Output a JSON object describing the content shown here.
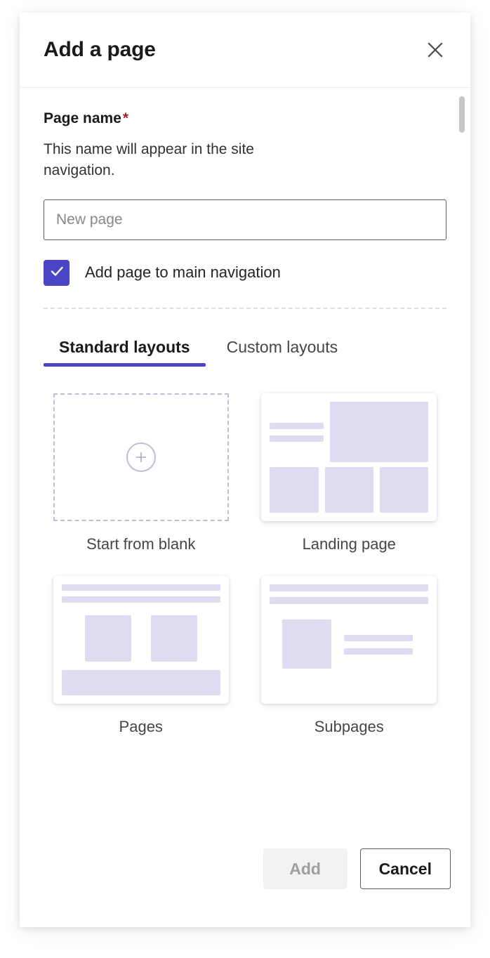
{
  "dialog": {
    "title": "Add a page",
    "close_icon": "close-icon"
  },
  "form": {
    "page_name_label": "Page name",
    "required_mark": "*",
    "page_name_description": "This name will appear in the site navigation.",
    "page_name_value": "",
    "page_name_placeholder": "New page",
    "checkbox": {
      "label": "Add page to main navigation",
      "checked": true,
      "accent_color": "#4b45c6"
    }
  },
  "tabs": {
    "active_index": 0,
    "accent_color": "#4b44c4",
    "items": [
      {
        "label": "Standard layouts",
        "active": true
      },
      {
        "label": "Custom layouts",
        "active": false
      }
    ]
  },
  "layouts": {
    "block_color": "#dfdcf2",
    "items": [
      {
        "caption": "Start from blank",
        "kind": "blank",
        "icon": "plus-circle-icon"
      },
      {
        "caption": "Landing page",
        "kind": "landing"
      },
      {
        "caption": "Pages",
        "kind": "pages"
      },
      {
        "caption": "Subpages",
        "kind": "subpages"
      }
    ]
  },
  "footer": {
    "add_label": "Add",
    "add_disabled": true,
    "cancel_label": "Cancel"
  }
}
